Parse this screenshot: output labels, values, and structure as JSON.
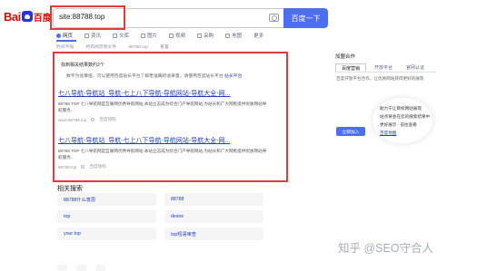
{
  "header": {
    "logo_text_left": "Bai",
    "logo_text_right": "百度",
    "search_value": "site:88788.top",
    "search_button": "百度一下"
  },
  "tabs": [
    {
      "label": "网页",
      "icon": "search-icon",
      "active": true
    },
    {
      "label": "资讯",
      "icon": "news-icon"
    },
    {
      "label": "文库",
      "icon": "doc-icon"
    },
    {
      "label": "图片",
      "icon": "image-icon"
    },
    {
      "label": "视频",
      "icon": "video-icon"
    },
    {
      "label": "采购",
      "icon": "cart-icon"
    },
    {
      "label": "地图",
      "icon": "map-icon"
    },
    {
      "label": "更多",
      "icon": ""
    }
  ],
  "tools": {
    "time": "时间不限",
    "filetype": "所有网页和文件",
    "site": "88788.top",
    "reset": "重置"
  },
  "notice": {
    "title": "找到相关结果数约2个",
    "text": "数字为估算值，可以使用百度站长平台了解更准确的收录量。请使用百度站长平台",
    "link": "站长平台"
  },
  "results": [
    {
      "title": "七八导航-导航站_导航-七上八下导航-导航网站-导航大全-网...",
      "desc": "88788.TOP 七八导航网是互联网优秀导航网站,本站立志成为综合门户导航网站,为站长和广大网民提供优质网站导航服务...",
      "url": "www.88788.top",
      "snapshot": "百度快照"
    },
    {
      "title": "七八导航-导航站_导航-七上八下导航-导航网站-导航大全-网...",
      "desc": "88788.TOP 七八导航网是互联网优秀导航网站,本站立志成为综合门户导航网站,为站长和广大网民提供优质网站导航服务...",
      "url": "88788.top",
      "snapshot": "百度快照"
    }
  ],
  "related": {
    "title": "相关搜索",
    "items": [
      "88788什么意思",
      "88788",
      "top",
      "desire",
      "your top",
      "top短语审查"
    ]
  },
  "side": {
    "title": "加盟合作",
    "tabs": [
      "百度营销",
      "开放平台",
      "官网认证"
    ],
    "text": "百度开放平台合作，让优质网站获得更好的展现",
    "button": "立即加入",
    "popup_lines": [
      "助力于让目标网站展现",
      "站点将会在您的搜索结果中",
      "更好展示 · 前往查看"
    ],
    "popup_link": "百度地图"
  },
  "watermark": "知乎 @SEO守合人",
  "colors": {
    "accent": "#4e6ef2",
    "highlight_box": "#e0393e",
    "link": "#2440b3"
  }
}
